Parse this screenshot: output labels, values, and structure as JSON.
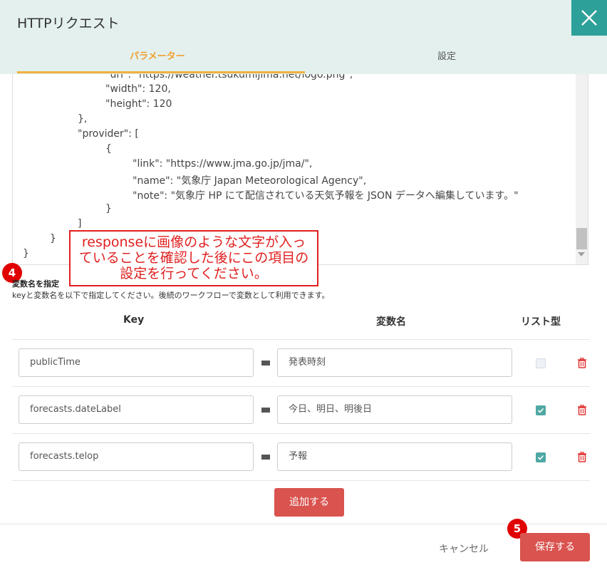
{
  "dialog": {
    "title": "HTTPリクエスト",
    "close_icon": "close-icon"
  },
  "tabs": [
    {
      "label": "パラメーター",
      "active": true
    },
    {
      "label": "設定",
      "active": false
    }
  ],
  "response_code": {
    "lines": [
      "\"url\": \"https://weather.tsukumijima.net/logo.png\",",
      "\"width\": 120,",
      "\"height\": 120",
      "},",
      "\"provider\": [",
      "{",
      "\"link\": \"https://www.jma.go.jp/jma/\",",
      "\"name\": \"気象庁 Japan Meteorological Agency\",",
      "\"note\": \"気象庁 HP にて配信されている天気予報を JSON データへ編集しています。\"",
      "}",
      "]",
      "}",
      "}"
    ]
  },
  "annotation": {
    "line1": "responseに画像のような文字が入っ",
    "line2": "ていることを確認した後にこの項目の",
    "line3": "設定を行ってください。"
  },
  "badges": {
    "step4": "4",
    "step5": "5"
  },
  "variables_section": {
    "title": "変数名を指定",
    "description": "keyと変数名を以下で指定してください。後続のワークフローで変数として利用できます。",
    "columns": {
      "key": "Key",
      "variable": "変数名",
      "list_type": "リスト型"
    },
    "rows": [
      {
        "key": "publicTime",
        "variable": "発表時刻",
        "is_list": false
      },
      {
        "key": "forecasts.dateLabel",
        "variable": "今日、明日、明後日",
        "is_list": true
      },
      {
        "key": "forecasts.telop",
        "variable": "予報",
        "is_list": true
      }
    ],
    "add_button": "追加する"
  },
  "footer": {
    "cancel": "キャンセル",
    "save": "保存する"
  },
  "colors": {
    "header_bg": "#e3f0ee",
    "close_bg": "#2ea09a",
    "active_tab": "#f0a030",
    "accent_red": "#d9534f",
    "checkbox_checked": "#4fa8a4",
    "annotation_red": "#e02020"
  }
}
